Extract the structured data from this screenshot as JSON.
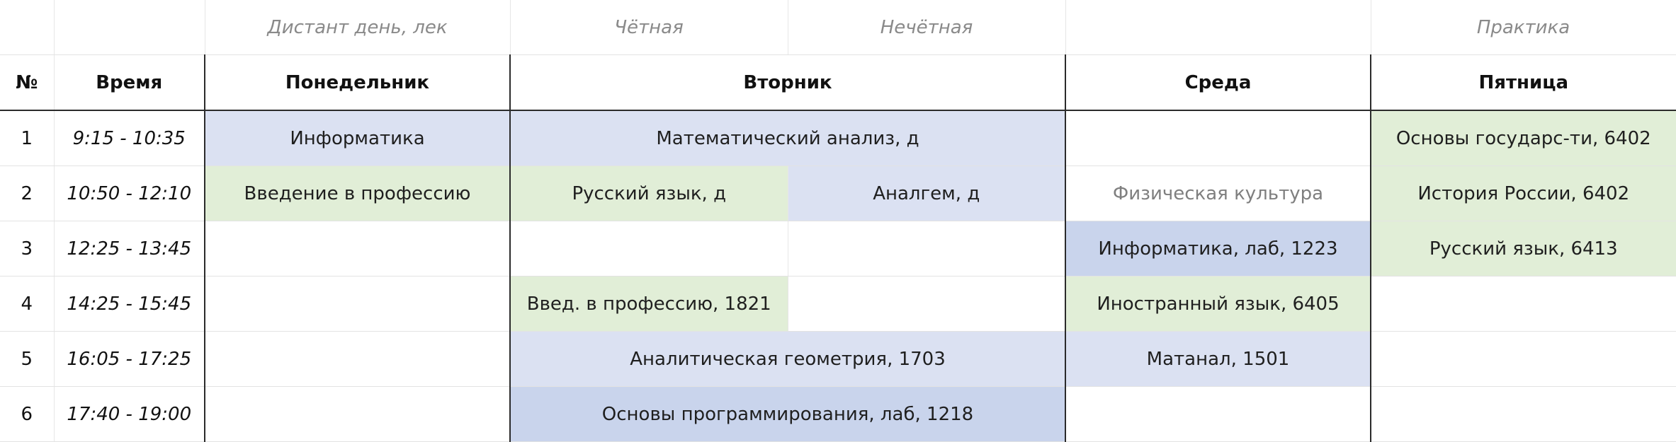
{
  "top_labels": {
    "monday": "Дистант день, лек",
    "even": "Чётная",
    "odd": "Нечётная",
    "friday": "Практика"
  },
  "headers": {
    "num": "№",
    "time": "Время",
    "monday": "Понедельник",
    "tuesday": "Вторник",
    "wednesday": "Среда",
    "friday": "Пятница"
  },
  "rows": [
    {
      "num": "1",
      "time": "9:15 - 10:35",
      "monday": "Информатика",
      "tuesday": "Математический анализ, д",
      "friday": "Основы государс-ти, 6402"
    },
    {
      "num": "2",
      "time": "10:50 - 12:10",
      "monday": "Введение в профессию",
      "tuesday_even": "Русский язык, д",
      "tuesday_odd": "Аналгем, д",
      "wednesday": "Физическая культура",
      "friday": "История России, 6402"
    },
    {
      "num": "3",
      "time": "12:25 - 13:45",
      "wednesday": "Информатика, лаб, 1223",
      "friday": "Русский язык, 6413"
    },
    {
      "num": "4",
      "time": "14:25 - 15:45",
      "tuesday_even": "Введ. в профессию, 1821",
      "wednesday": "Иностранный язык, 6405"
    },
    {
      "num": "5",
      "time": "16:05 - 17:25",
      "tuesday": "Аналитическая геометрия, 1703",
      "wednesday": "Матанал, 1501"
    },
    {
      "num": "6",
      "time": "17:40 - 19:00",
      "tuesday": "Основы программирования, лаб, 1218"
    }
  ],
  "colors": {
    "blue": "#dbe1f2",
    "blue_dark": "#c9d4ec",
    "green": "#e1eed7",
    "border": "#2b2b2b"
  }
}
